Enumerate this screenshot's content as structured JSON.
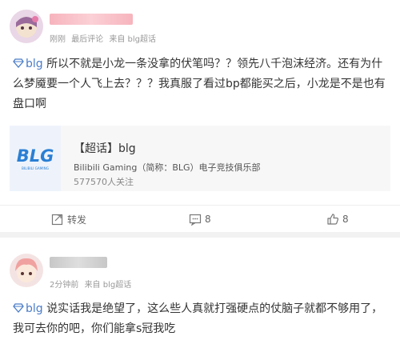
{
  "post1": {
    "meta": {
      "time": "刚刚",
      "sep": "最后评论",
      "source": "来自 blg超话"
    },
    "topic": "blg",
    "text": "所以不就是小龙一条没拿的伏笔吗？？领先八千泡沫经济。还有为什么梦魇要一个人飞上去？？？我真服了看过bp都能买之后，小龙是不是也有盘口啊",
    "share": {
      "logo_text": "BLG",
      "logo_sub": "BILIBILI GAMING",
      "title": "【超话】blg",
      "subtitle": "Bilibili Gaming（简称：BLG）电子竞技俱乐部",
      "followers": "577570人关注"
    },
    "actions": {
      "repost": "转发",
      "comments": "8",
      "likes": "8"
    }
  },
  "post2": {
    "meta": {
      "time": "2分钟前",
      "source": "来自 blg超话"
    },
    "topic": "blg",
    "text": "说实话我是绝望了，这么些人真就打强硬点的仗脑子就都不够用了，我可去你的吧，你们能拿s冠我吃"
  },
  "colors": {
    "topic": "#4a7cc8",
    "logo_blue": "#2a7fd4"
  },
  "icons": [
    "topic-diamond-icon",
    "repost-icon",
    "comment-icon",
    "like-icon"
  ]
}
